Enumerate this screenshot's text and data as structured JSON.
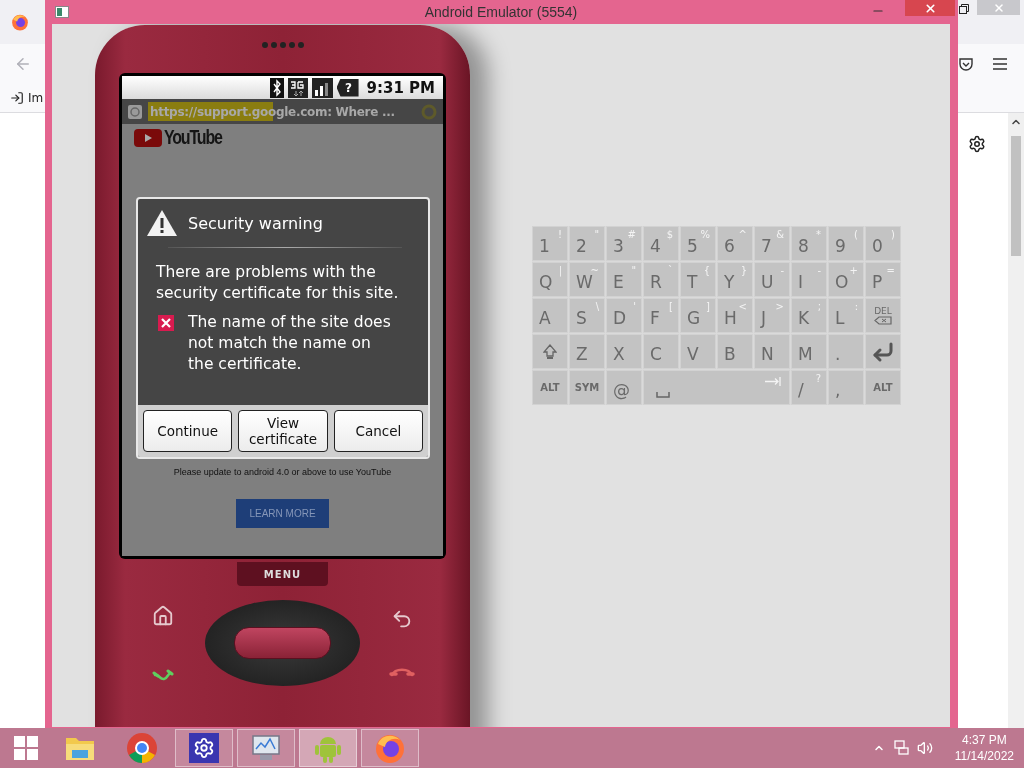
{
  "background_browser": {
    "bookmark_label": "Im"
  },
  "emulator_window": {
    "title": "Android Emulator (5554)"
  },
  "phone": {
    "status_bar": {
      "battery_glyph": "?",
      "time": "9:31 PM"
    },
    "url_bar": {
      "url": "https://support.google.com: Where ...",
      "level": 0.47
    },
    "page": {
      "logo_text": "YouTube",
      "notice": "Please update to android 4.0 or above to use YouTube",
      "button": "LEARN MORE"
    },
    "dialog": {
      "title": "Security warning",
      "message": "There are problems with the security certificate for this site.",
      "errors": [
        {
          "text": "The name of the site does not match the name on the certificate."
        }
      ],
      "buttons": [
        "Continue",
        "View certificate",
        "Cancel"
      ]
    },
    "menu_key": "MENU"
  },
  "keyboard": {
    "rows": [
      [
        {
          "kind": "char",
          "label": "1",
          "alt": "!"
        },
        {
          "kind": "char",
          "label": "2",
          "alt": "\""
        },
        {
          "kind": "char",
          "label": "3",
          "alt": "#"
        },
        {
          "kind": "char",
          "label": "4",
          "alt": "$"
        },
        {
          "kind": "char",
          "label": "5",
          "alt": "%"
        },
        {
          "kind": "char",
          "label": "6",
          "alt": "^"
        },
        {
          "kind": "char",
          "label": "7",
          "alt": "&"
        },
        {
          "kind": "char",
          "label": "8",
          "alt": "*"
        },
        {
          "kind": "char",
          "label": "9",
          "alt": "("
        },
        {
          "kind": "char",
          "label": "0",
          "alt": ")"
        }
      ],
      [
        {
          "kind": "char",
          "label": "Q",
          "alt": "|"
        },
        {
          "kind": "char",
          "label": "W",
          "alt": "~"
        },
        {
          "kind": "char",
          "label": "E",
          "alt": "\""
        },
        {
          "kind": "char",
          "label": "R",
          "alt": "`"
        },
        {
          "kind": "char",
          "label": "T",
          "alt": "{"
        },
        {
          "kind": "char",
          "label": "Y",
          "alt": "}"
        },
        {
          "kind": "char",
          "label": "U",
          "alt": "-"
        },
        {
          "kind": "char",
          "label": "I",
          "alt": "-"
        },
        {
          "kind": "char",
          "label": "O",
          "alt": "+"
        },
        {
          "kind": "char",
          "label": "P",
          "alt": "="
        }
      ],
      [
        {
          "kind": "char",
          "label": "A"
        },
        {
          "kind": "char",
          "label": "S",
          "alt": "\\"
        },
        {
          "kind": "char",
          "label": "D",
          "alt": "'"
        },
        {
          "kind": "char",
          "label": "F",
          "alt": "["
        },
        {
          "kind": "char",
          "label": "G",
          "alt": "]"
        },
        {
          "kind": "char",
          "label": "H",
          "alt": "<"
        },
        {
          "kind": "char",
          "label": "J",
          "alt": ">"
        },
        {
          "kind": "char",
          "label": "K",
          "alt": ";"
        },
        {
          "kind": "char",
          "label": "L",
          "alt": ":"
        },
        {
          "kind": "del",
          "label": "DEL"
        }
      ],
      [
        {
          "kind": "shift"
        },
        {
          "kind": "char",
          "label": "Z"
        },
        {
          "kind": "char",
          "label": "X"
        },
        {
          "kind": "char",
          "label": "C"
        },
        {
          "kind": "char",
          "label": "V"
        },
        {
          "kind": "char",
          "label": "B"
        },
        {
          "kind": "char",
          "label": "N"
        },
        {
          "kind": "char",
          "label": "M"
        },
        {
          "kind": "char",
          "label": "."
        },
        {
          "kind": "enter"
        }
      ],
      [
        {
          "kind": "mod",
          "label": "ALT"
        },
        {
          "kind": "mod",
          "label": "SYM"
        },
        {
          "kind": "char",
          "label": "@"
        },
        {
          "kind": "space"
        },
        "",
        "",
        "",
        {
          "kind": "char",
          "label": "/",
          "alt": "?"
        },
        {
          "kind": "char",
          "label": ","
        },
        {
          "kind": "mod",
          "label": "ALT"
        }
      ]
    ]
  },
  "taskbar": {
    "apps": [
      {
        "kind": "explorer",
        "running": false,
        "selected": false
      },
      {
        "kind": "chrome",
        "running": false,
        "selected": false
      },
      {
        "kind": "settings",
        "running": true,
        "selected": false
      },
      {
        "kind": "monitor",
        "running": true,
        "selected": false
      },
      {
        "kind": "android",
        "running": true,
        "selected": true
      },
      {
        "kind": "firefox",
        "running": true,
        "selected": false
      }
    ],
    "time": "4:37 PM",
    "date": "11/14/2022"
  }
}
